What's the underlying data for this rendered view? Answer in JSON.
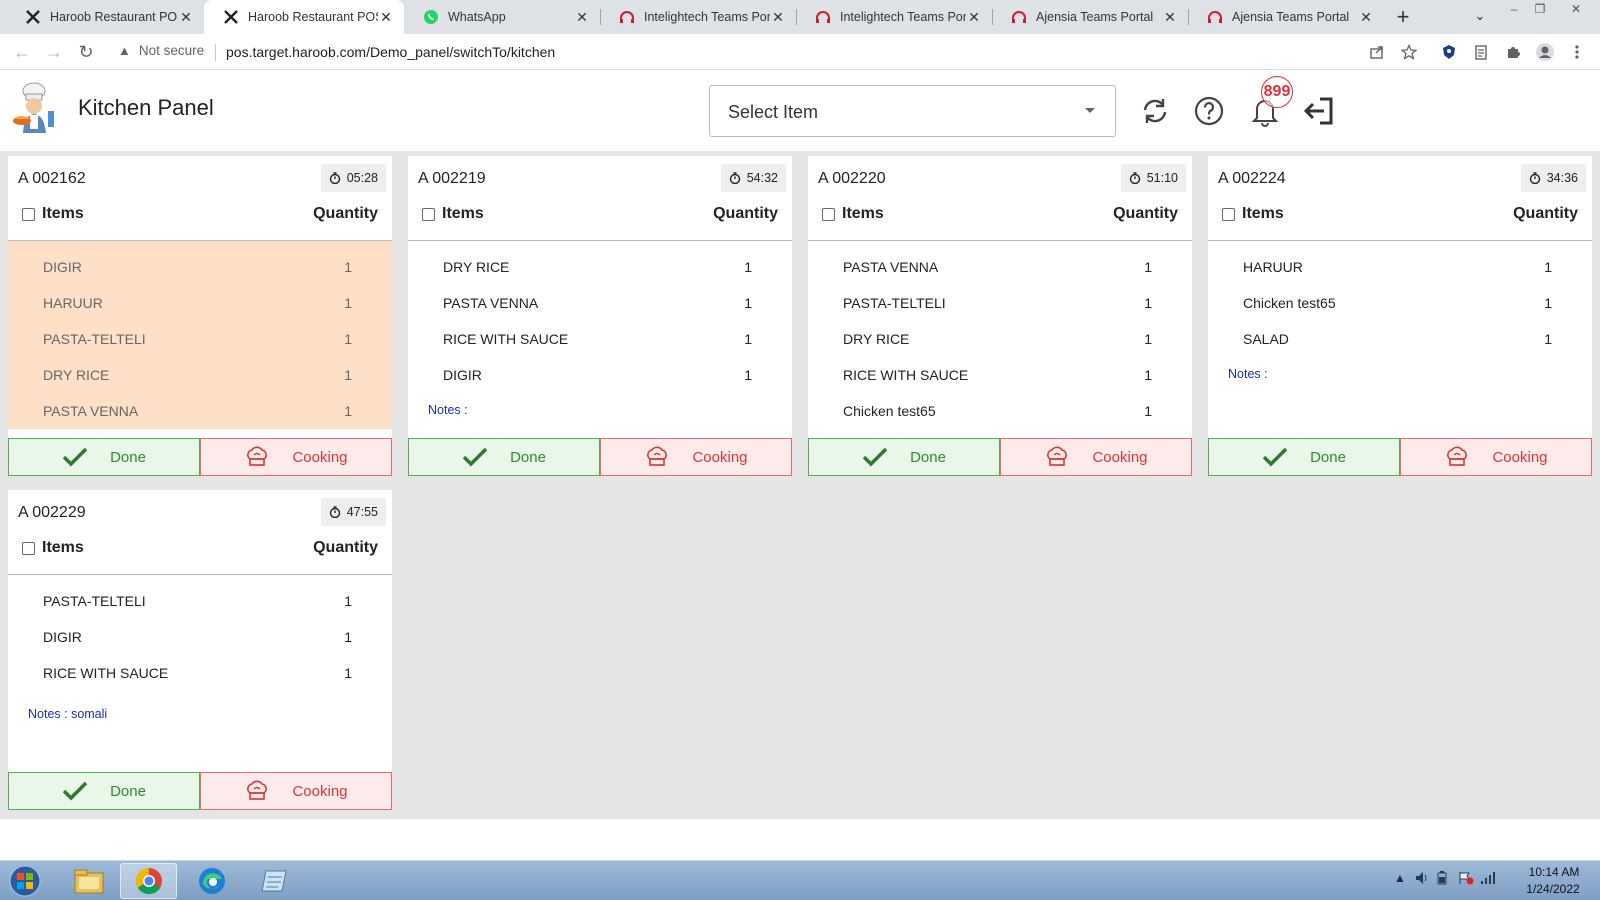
{
  "browser": {
    "tabs": [
      {
        "title": "Haroob Restaurant POS",
        "icon": "haroob-x-icon",
        "active": false
      },
      {
        "title": "Haroob Restaurant POS",
        "icon": "haroob-x-icon",
        "active": true
      },
      {
        "title": "WhatsApp",
        "icon": "whatsapp-icon",
        "active": false
      },
      {
        "title": "Intelightech Teams Portal",
        "icon": "headset-icon",
        "active": false
      },
      {
        "title": "Intelightech Teams Portal",
        "icon": "headset-icon",
        "active": false
      },
      {
        "title": "Ajensia Teams Portal",
        "icon": "headset-icon",
        "active": false
      },
      {
        "title": "Ajensia Teams Portal",
        "icon": "headset-icon",
        "active": false
      }
    ],
    "security_label": "Not secure",
    "url": "pos.target.haroob.com/Demo_panel/switchTo/kitchen"
  },
  "app": {
    "title": "Kitchen Panel",
    "select_placeholder": "Select Item",
    "notification_count": "899",
    "colors": {
      "highlight": "#fde0c5",
      "done": "#2f8a2f",
      "cooking": "#d9343b",
      "notes": "#1a2fa8"
    }
  },
  "labels": {
    "items": "Items",
    "quantity": "Quantity",
    "done": "Done",
    "cooking": "Cooking"
  },
  "orders": [
    {
      "number": "A 002162",
      "timer": "05:28",
      "highlight": true,
      "items": [
        {
          "name": "DIGIR",
          "qty": "1"
        },
        {
          "name": "HARUUR",
          "qty": "1"
        },
        {
          "name": "PASTA-TELTELI",
          "qty": "1"
        },
        {
          "name": "DRY RICE",
          "qty": "1"
        },
        {
          "name": "PASTA VENNA",
          "qty": "1"
        }
      ],
      "notes": null
    },
    {
      "number": "A 002219",
      "timer": "54:32",
      "highlight": false,
      "items": [
        {
          "name": "DRY RICE",
          "qty": "1"
        },
        {
          "name": "PASTA VENNA",
          "qty": "1"
        },
        {
          "name": "RICE WITH SAUCE",
          "qty": "1"
        },
        {
          "name": "DIGIR",
          "qty": "1"
        }
      ],
      "notes": "Notes :"
    },
    {
      "number": "A 002220",
      "timer": "51:10",
      "highlight": false,
      "items": [
        {
          "name": "PASTA VENNA",
          "qty": "1"
        },
        {
          "name": "PASTA-TELTELI",
          "qty": "1"
        },
        {
          "name": "DRY RICE",
          "qty": "1"
        },
        {
          "name": "RICE WITH SAUCE",
          "qty": "1"
        },
        {
          "name": "Chicken test65",
          "qty": "1"
        }
      ],
      "notes": null
    },
    {
      "number": "A 002224",
      "timer": "34:36",
      "highlight": false,
      "items": [
        {
          "name": "HARUUR",
          "qty": "1"
        },
        {
          "name": "Chicken test65",
          "qty": "1"
        },
        {
          "name": "SALAD",
          "qty": "1"
        }
      ],
      "notes": "Notes :"
    },
    {
      "number": "A 002229",
      "timer": "47:55",
      "highlight": false,
      "items": [
        {
          "name": "PASTA-TELTELI",
          "qty": "1"
        },
        {
          "name": "DIGIR",
          "qty": "1"
        },
        {
          "name": "RICE WITH SAUCE",
          "qty": "1"
        }
      ],
      "notes": "Notes : somali"
    }
  ],
  "taskbar": {
    "apps": [
      "windows-explorer-icon",
      "chrome-icon",
      "edge-icon",
      "notepad-icon"
    ],
    "time": "10:14 AM",
    "date": "1/24/2022"
  }
}
